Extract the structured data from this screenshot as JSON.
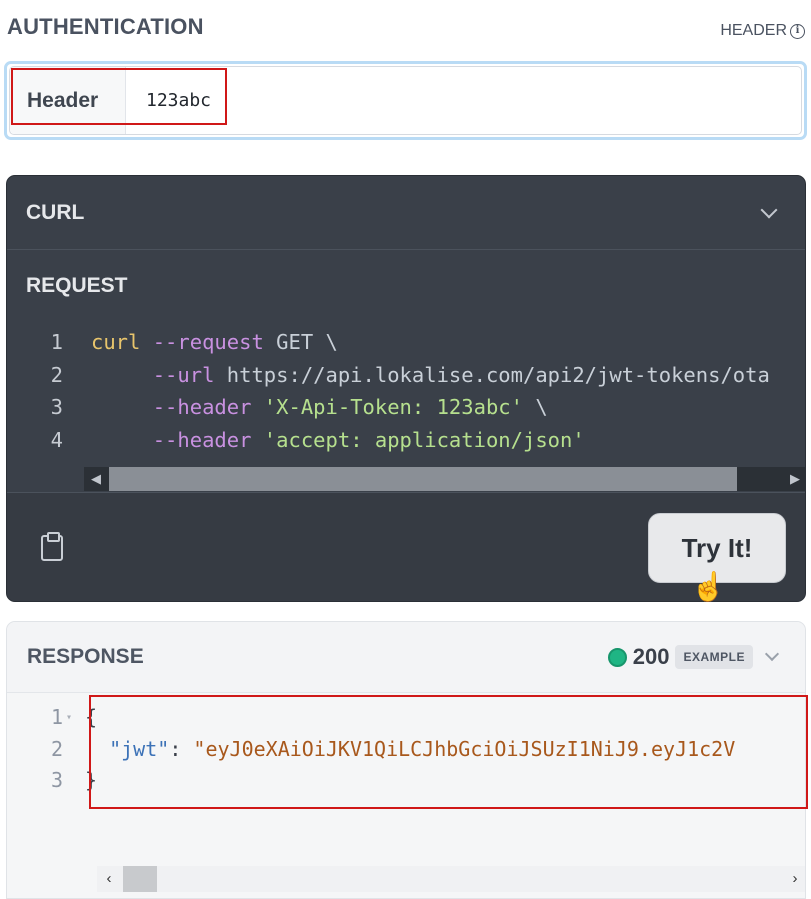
{
  "auth": {
    "title": "AUTHENTICATION",
    "type_label": "HEADER",
    "field_label": "Header",
    "field_value": "123abc"
  },
  "curl": {
    "title": "CURL",
    "request_title": "REQUEST",
    "lines": [
      {
        "num": "1",
        "parts": [
          [
            "curl ",
            "yellow"
          ],
          [
            "--request ",
            "purple"
          ],
          [
            "GET \\",
            "plain"
          ]
        ]
      },
      {
        "num": "2",
        "parts": [
          [
            "     --url ",
            "purple"
          ],
          [
            "https://api.lokalise.com/api2/jwt-tokens/ota",
            "plain"
          ]
        ]
      },
      {
        "num": "3",
        "parts": [
          [
            "     --header ",
            "purple"
          ],
          [
            "'X-Api-Token: 123abc'",
            "green"
          ],
          [
            " \\",
            "plain"
          ]
        ]
      },
      {
        "num": "4",
        "parts": [
          [
            "     --header ",
            "purple"
          ],
          [
            "'accept: application/json'",
            "green"
          ]
        ]
      }
    ],
    "try_label": "Try It!"
  },
  "response": {
    "title": "RESPONSE",
    "status_code": "200",
    "badge": "EXAMPLE",
    "lines": [
      {
        "num": "1",
        "fold": "▾",
        "parts": [
          [
            "{",
            "plain"
          ]
        ]
      },
      {
        "num": "2",
        "fold": "",
        "parts": [
          [
            "  ",
            "plain"
          ],
          [
            "\"jwt\"",
            "key"
          ],
          [
            ": ",
            "plain"
          ],
          [
            "\"eyJ0eXAiOiJKV1QiLCJhbGciOiJSUzI1NiJ9.eyJ1c2V",
            "str"
          ]
        ]
      },
      {
        "num": "3",
        "fold": "",
        "parts": [
          [
            "}",
            "plain"
          ]
        ]
      }
    ]
  },
  "colors": {
    "accent_dot": "#1fb584",
    "highlight_box": "#d01818"
  }
}
